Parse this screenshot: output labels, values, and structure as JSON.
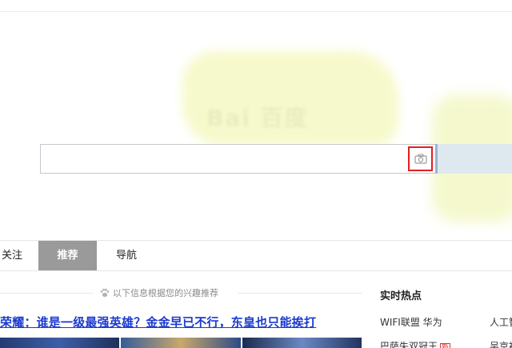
{
  "search": {
    "value": "",
    "placeholder": ""
  },
  "logo": {
    "text": "Bai 百度"
  },
  "tabs": [
    {
      "label": "关注"
    },
    {
      "label": "推荐"
    },
    {
      "label": "导航"
    }
  ],
  "feed": {
    "hint": "以下信息根据您的兴趣推荐",
    "headline": "荣耀：谁是一级最强英雄？金金早已不行，东皇也只能挨打"
  },
  "hot": {
    "title": "实时热点",
    "items": [
      {
        "label": "WIFI联盟 华为"
      },
      {
        "label": "人工智"
      },
      {
        "label": "巴萨失双冠王",
        "badge": "新"
      },
      {
        "label": "吴京被"
      }
    ]
  },
  "colors": {
    "accent_tab": "#9a9a9a",
    "link": "#1a3ad0",
    "camera_highlight": "#e02020"
  }
}
